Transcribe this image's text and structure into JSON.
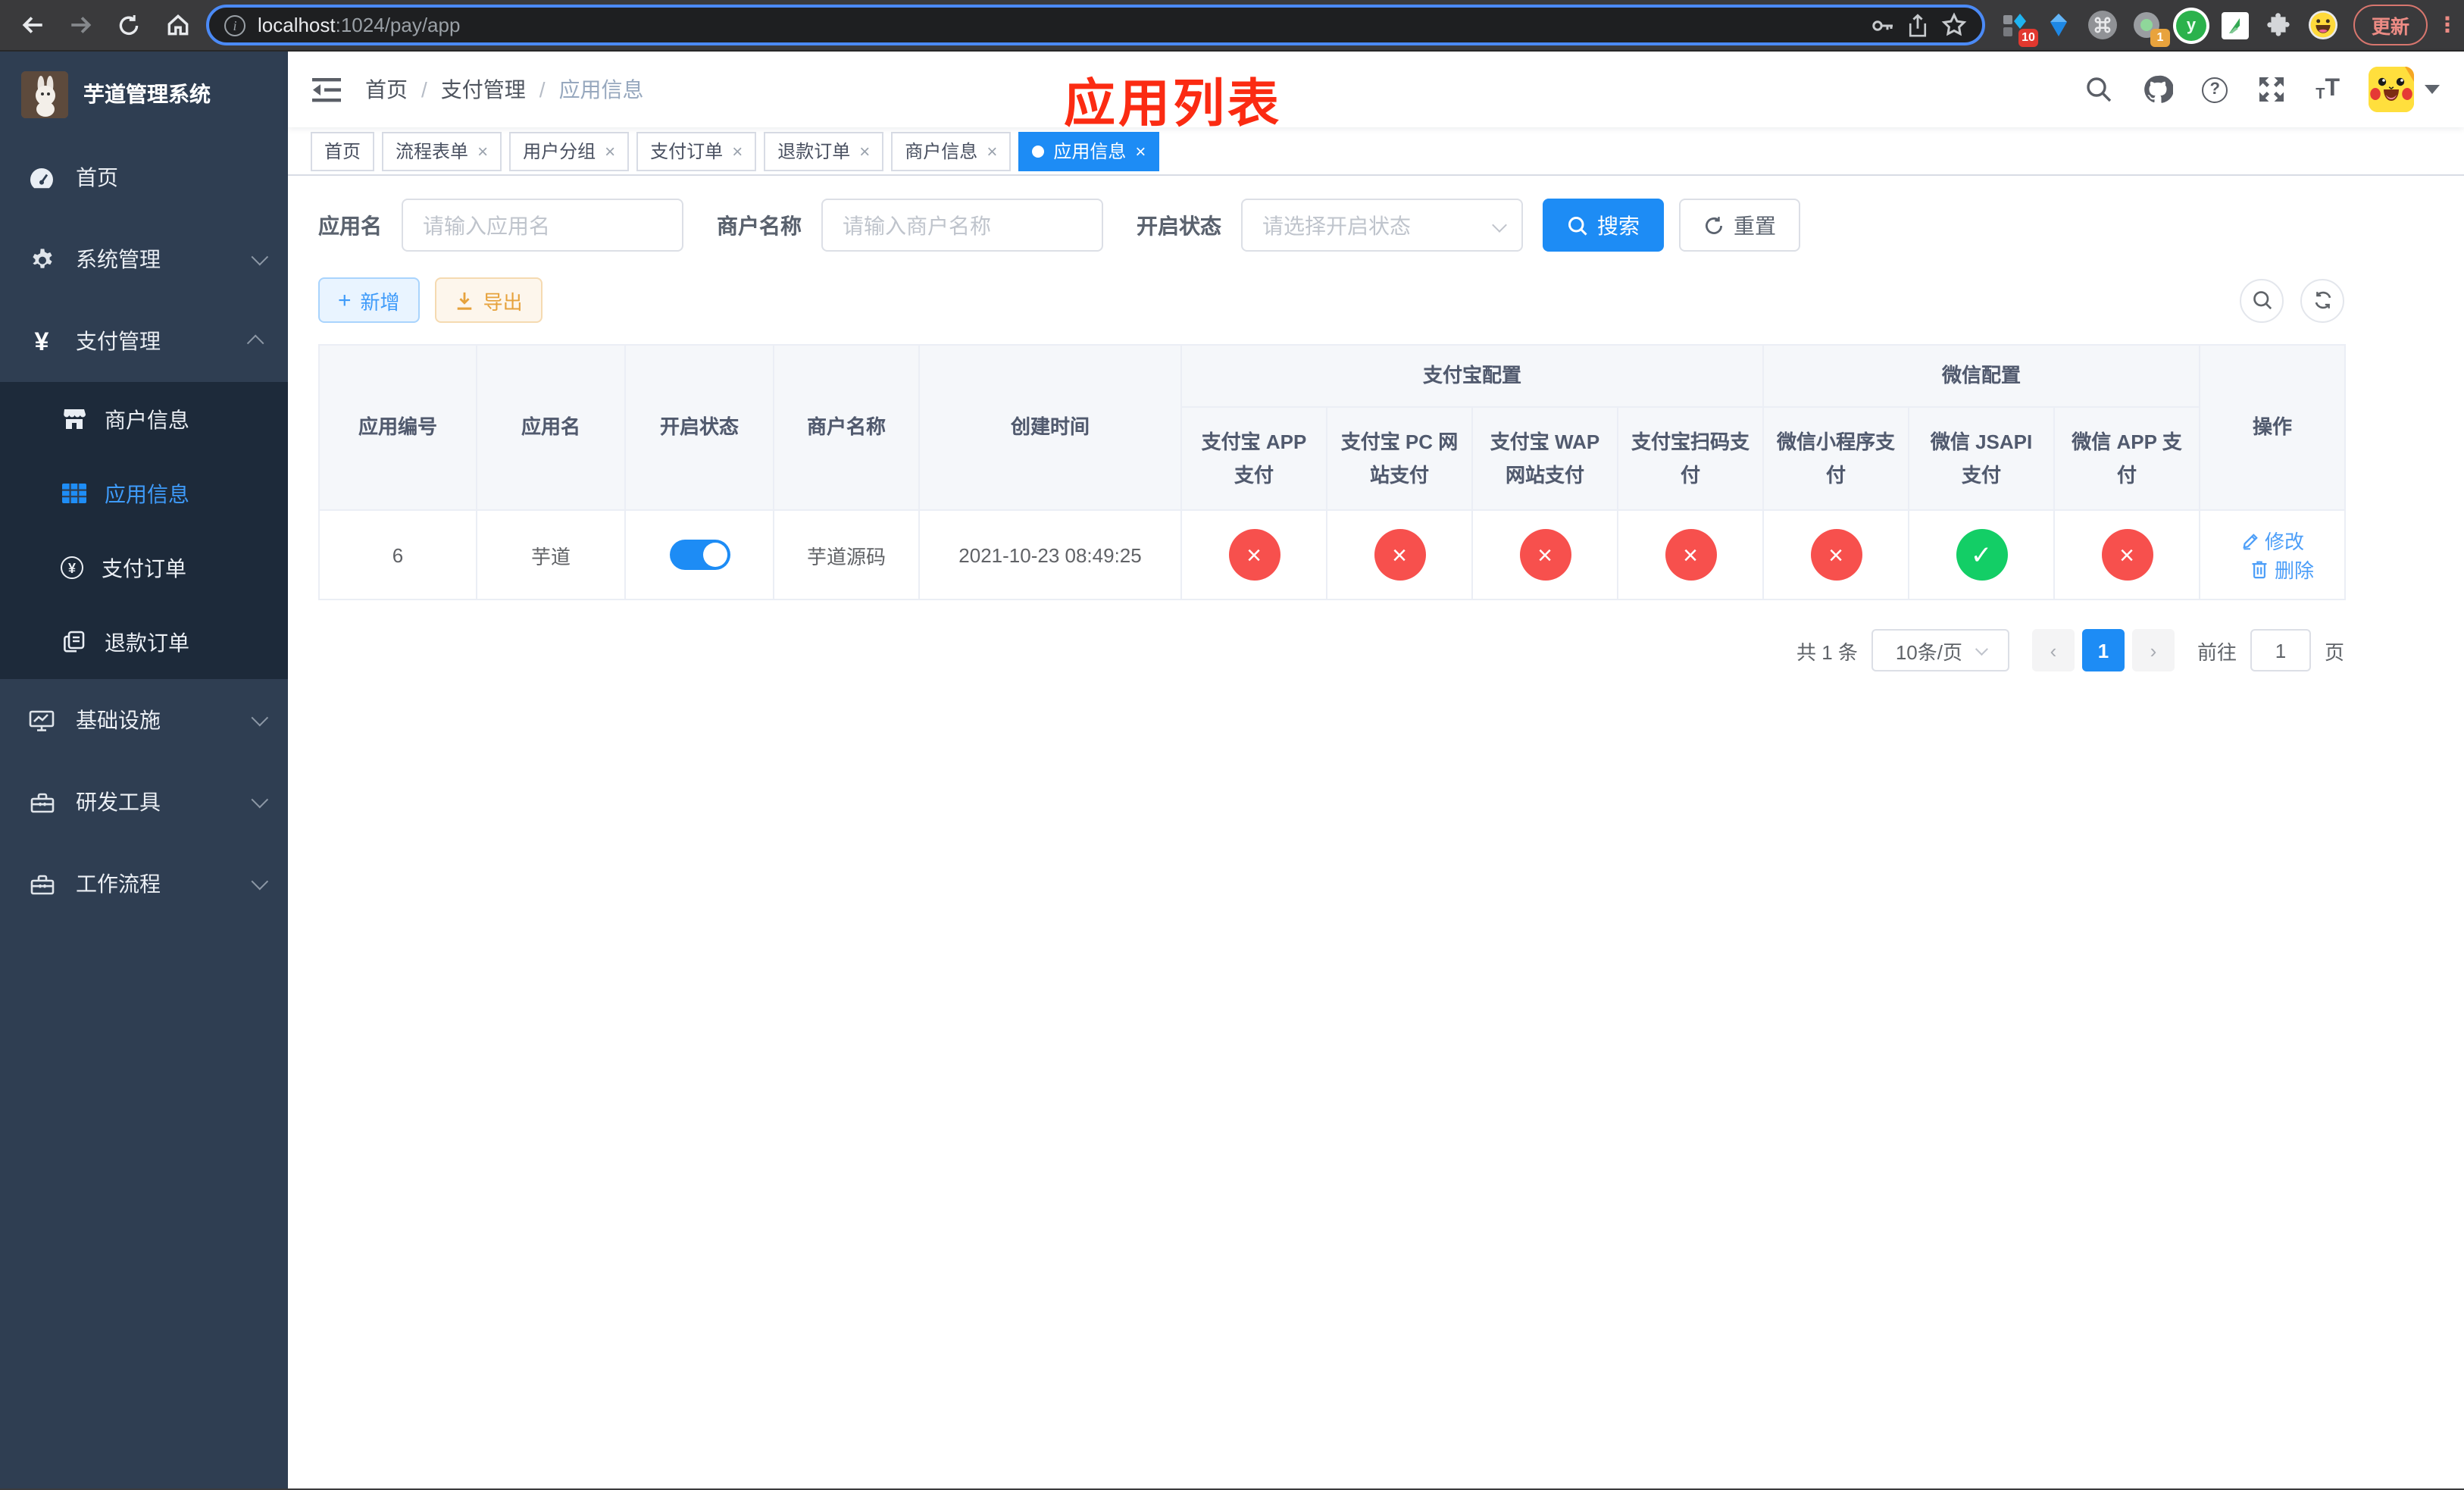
{
  "browser": {
    "url_host": "localhost",
    "url_rest": ":1024/pay/app",
    "update_button": "更新",
    "extension_badge_grid": "10",
    "extension_badge_record": "1",
    "extension_letter": "y"
  },
  "sidebar": {
    "title": "芋道管理系统",
    "items": [
      {
        "label": "首页",
        "icon": "dashboard-icon",
        "expandable": false
      },
      {
        "label": "系统管理",
        "icon": "gear-icon",
        "expandable": true,
        "state": "collapsed"
      },
      {
        "label": "支付管理",
        "icon": "yen-icon",
        "expandable": true,
        "state": "expanded"
      },
      {
        "label": "基础设施",
        "icon": "monitor-icon",
        "expandable": true,
        "state": "collapsed"
      },
      {
        "label": "研发工具",
        "icon": "toolbox-icon",
        "expandable": true,
        "state": "collapsed"
      },
      {
        "label": "工作流程",
        "icon": "toolbox-icon",
        "expandable": true,
        "state": "collapsed"
      }
    ],
    "submenu": [
      {
        "label": "商户信息",
        "icon": "shop-icon",
        "active": false
      },
      {
        "label": "应用信息",
        "icon": "grid-icon",
        "active": true
      },
      {
        "label": "支付订单",
        "icon": "pay-order-icon",
        "active": false
      },
      {
        "label": "退款订单",
        "icon": "refund-icon",
        "active": false
      }
    ]
  },
  "navbar": {
    "breadcrumb": {
      "0": "首页",
      "1": "支付管理",
      "2": "应用信息",
      "separator": "/"
    },
    "annotation": "应用列表"
  },
  "tags": {
    "items": [
      {
        "label": "首页",
        "closable": false,
        "active": false
      },
      {
        "label": "流程表单",
        "closable": true,
        "active": false
      },
      {
        "label": "用户分组",
        "closable": true,
        "active": false
      },
      {
        "label": "支付订单",
        "closable": true,
        "active": false
      },
      {
        "label": "退款订单",
        "closable": true,
        "active": false
      },
      {
        "label": "商户信息",
        "closable": true,
        "active": false
      },
      {
        "label": "应用信息",
        "closable": true,
        "active": true
      }
    ],
    "close_glyph": "×"
  },
  "search": {
    "app_name_label": "应用名",
    "app_name_placeholder": "请输入应用名",
    "merchant_label": "商户名称",
    "merchant_placeholder": "请输入商户名称",
    "status_label": "开启状态",
    "status_placeholder": "请选择开启状态",
    "search_button": "搜索",
    "reset_button": "重置"
  },
  "toolbar": {
    "add_button": "新增",
    "export_button": "导出"
  },
  "table": {
    "columns": {
      "app_id": "应用编号",
      "app_name": "应用名",
      "status": "开启状态",
      "merchant": "商户名称",
      "create_time": "创建时间",
      "action": "操作"
    },
    "groups": {
      "alipay": "支付宝配置",
      "wechat": "微信配置"
    },
    "pay_columns": {
      "0": "支付宝 APP 支付",
      "1": "支付宝 PC 网站支付",
      "2": "支付宝 WAP 网站支付",
      "3": "支付宝扫码支付",
      "4": "微信小程序支付",
      "5": "微信 JSAPI 支付",
      "6": "微信 APP 支付"
    },
    "rows": [
      {
        "app_id": "6",
        "app_name": "芋道",
        "enabled": true,
        "merchant": "芋道源码",
        "create_time": "2021-10-23 08:49:25",
        "payment_statuses": [
          "fail",
          "fail",
          "fail",
          "fail",
          "fail",
          "success",
          "fail"
        ],
        "edit_label": "修改",
        "delete_label": "删除"
      }
    ]
  },
  "pagination": {
    "total_text": "共 1 条",
    "page_size": "10条/页",
    "prev_glyph": "‹",
    "current_page": "1",
    "next_glyph": "›",
    "goto_label": "前往",
    "goto_value": "1",
    "goto_suffix": "页"
  },
  "colors": {
    "primary": "#1d8cf5",
    "sidebar_bg": "#2f3e52",
    "submenu_bg": "#1d2a3a",
    "active_menu_text": "#3e9bfa",
    "danger_status": "#f7504d",
    "success_status": "#13ce66",
    "export_accent": "#e6a23c",
    "annotation_red": "#fb2b12"
  }
}
